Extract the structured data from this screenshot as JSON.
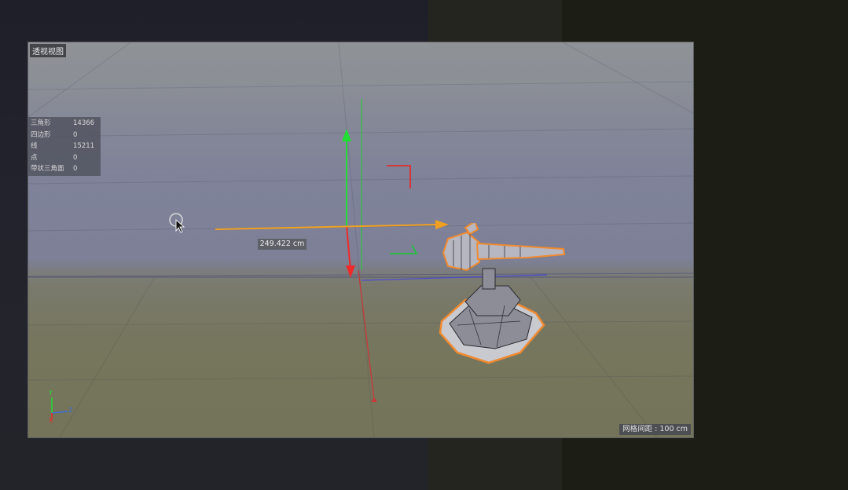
{
  "viewport": {
    "title": "透视视图",
    "stats": [
      {
        "label": "三角形",
        "value": "14366"
      },
      {
        "label": "四边形",
        "value": "0"
      },
      {
        "label": "线",
        "value": "15211"
      },
      {
        "label": "点",
        "value": "0"
      },
      {
        "label": "带状三角面",
        "value": "0"
      }
    ],
    "measurement": "249.422 cm",
    "grid_spacing": "网格间距 : 100 cm",
    "axes": {
      "x": "Z",
      "y": "Y",
      "z": "X"
    }
  },
  "colors": {
    "y_axis": "#22dd33",
    "x_axis": "#ee2a2a",
    "z_axis": "#f0a020",
    "selection": "#f08a30",
    "viewport_border": "#5c5e62"
  },
  "icons": [
    "mouse-cursor-icon",
    "move-gizmo-icon",
    "axis-indicator-icon"
  ]
}
